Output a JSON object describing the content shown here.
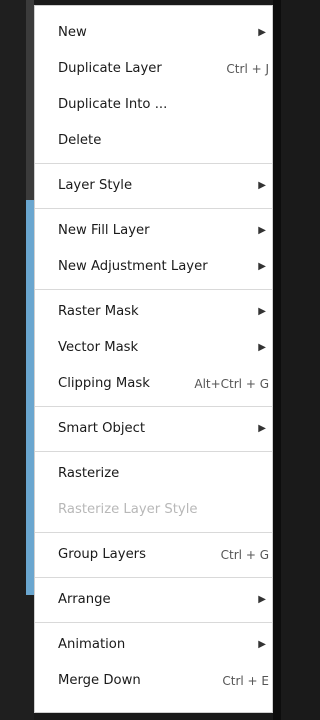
{
  "menu": {
    "items": [
      {
        "label": "New",
        "submenu_icon": "triangle-right-icon"
      },
      {
        "label": "Duplicate Layer",
        "shortcut": "Ctrl + J"
      },
      {
        "label": "Duplicate Into ..."
      },
      {
        "label": "Delete"
      },
      {
        "label": "Layer Style",
        "submenu_icon": "triangle-right-icon"
      },
      {
        "label": "New Fill Layer",
        "submenu_icon": "triangle-right-icon"
      },
      {
        "label": "New Adjustment Layer",
        "submenu_icon": "triangle-right-icon"
      },
      {
        "label": "Raster Mask",
        "submenu_icon": "triangle-right-icon"
      },
      {
        "label": "Vector Mask",
        "submenu_icon": "triangle-right-icon"
      },
      {
        "label": "Clipping Mask",
        "shortcut": "Alt+Ctrl + G"
      },
      {
        "label": "Smart Object",
        "submenu_icon": "triangle-right-icon"
      },
      {
        "label": "Rasterize"
      },
      {
        "label": "Rasterize Layer Style",
        "disabled": true
      },
      {
        "label": "Group Layers",
        "shortcut": "Ctrl + G"
      },
      {
        "label": "Arrange",
        "submenu_icon": "triangle-right-icon"
      },
      {
        "label": "Animation",
        "submenu_icon": "triangle-right-icon"
      },
      {
        "label": "Merge Down",
        "shortcut": "Ctrl + E"
      }
    ],
    "arrow_glyph": "▶"
  }
}
